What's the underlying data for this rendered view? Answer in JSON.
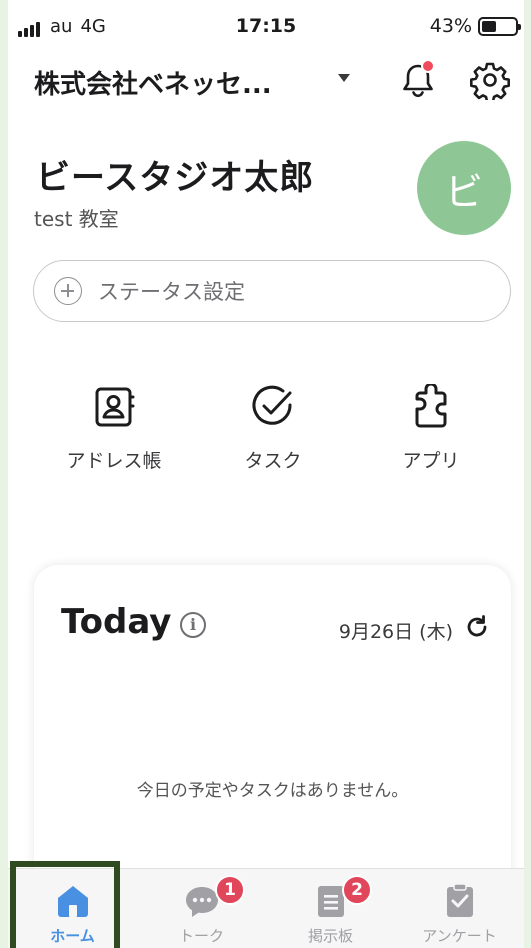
{
  "status_bar": {
    "carrier": "au",
    "network": "4G",
    "time": "17:15",
    "battery": "43%",
    "battery_level": 0.43
  },
  "header": {
    "organization": "株式会社ベネッセ...",
    "notification_dot": true
  },
  "profile": {
    "name": "ビースタジオ太郎",
    "classroom": "test 教室",
    "avatar_initial": "ビ",
    "avatar_color": "#8ec795"
  },
  "status_field": {
    "placeholder": "ステータス設定"
  },
  "shortcuts": [
    {
      "label": "アドレス帳",
      "icon": "address-book-icon"
    },
    {
      "label": "タスク",
      "icon": "task-check-icon"
    },
    {
      "label": "アプリ",
      "icon": "puzzle-icon"
    }
  ],
  "today": {
    "title": "Today",
    "date": "9月26日 (木)",
    "empty_message": "今日の予定やタスクはありません。"
  },
  "tabs": [
    {
      "label": "ホーム",
      "icon": "home-icon",
      "active": true,
      "badge": ""
    },
    {
      "label": "トーク",
      "icon": "chat-icon",
      "active": false,
      "badge": "1"
    },
    {
      "label": "掲示板",
      "icon": "bulletin-icon",
      "active": false,
      "badge": "2"
    },
    {
      "label": "アンケート",
      "icon": "survey-icon",
      "active": false,
      "badge": ""
    }
  ],
  "colors": {
    "accent": "#4a90e2",
    "badge": "#e0475b",
    "avatar": "#8ec795",
    "highlight_frame": "#2f4b1f"
  }
}
